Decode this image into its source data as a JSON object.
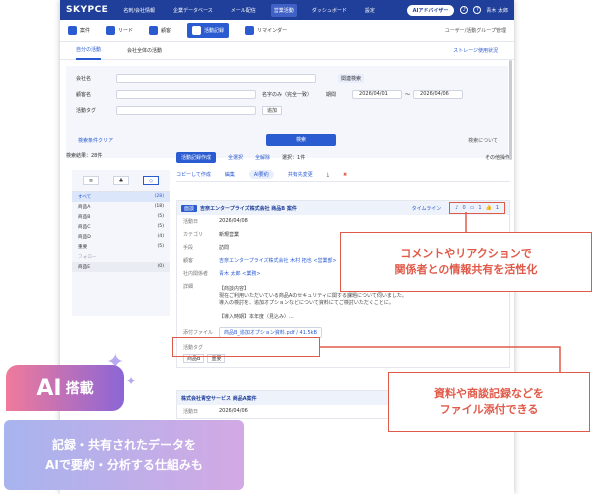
{
  "app": {
    "logo": "SKYPCE"
  },
  "topnav": {
    "items": [
      "名刺/会社情報",
      "企業データベース",
      "メール配信",
      "営業活動",
      "ダッシュボード",
      "設定"
    ],
    "active_index": 3,
    "ai_button": "AIアドバイザー",
    "bell_icon": "bell-icon",
    "help_icon": "help-icon",
    "user": "青木 太郎"
  },
  "modules": {
    "items": [
      "案件",
      "リード",
      "顧客",
      "活動記録",
      "リマインダー"
    ],
    "active_index": 3,
    "right": "ユーザー/活動グループ管理"
  },
  "subtabs": {
    "items": [
      "自分の活動",
      "会社全体の活動"
    ],
    "active_index": 0,
    "right": "ストレージ使用状況"
  },
  "search": {
    "company_label": "会社名",
    "name_label": "顧客名",
    "name_option": "名字のみ（完全一致）",
    "tag_label": "活動タグ",
    "tag_button": "追加",
    "related_label": "関連検索",
    "date_label": "期間",
    "date_from": "2026/04/01",
    "date_sep": "〜",
    "date_to": "2026/04/06",
    "clear": "検索条件クリア",
    "search_button": "検索",
    "about": "検索について"
  },
  "list": {
    "count_label": "検索結果：28件"
  },
  "left_panel": {
    "items": [
      {
        "label": "すべて",
        "count": "(28)",
        "selected": true
      },
      {
        "label": "商品A",
        "count": "(18)"
      },
      {
        "label": "商品B",
        "count": "(5)"
      },
      {
        "label": "商品C",
        "count": "(5)"
      },
      {
        "label": "商品D",
        "count": "(4)"
      },
      {
        "label": "重要",
        "count": "(5)"
      },
      {
        "label": "フォロー",
        "count": "",
        "muted": true
      },
      {
        "label": "商品E",
        "count": "(0)"
      }
    ]
  },
  "toolbar": {
    "new_button": "活動記録作成",
    "select_all": "全選択",
    "deselect": "全解除",
    "selected": "選択：1件",
    "more": "その他操作",
    "copy": "コピーして作成",
    "edit": "編集",
    "ai": "AI要約",
    "share": "共有先変更",
    "download_icon": "download-icon",
    "delete_icon": "trash-icon"
  },
  "card1": {
    "tag": "面談",
    "title": "吉奈エンタープライズ株式会社 商品B 案件",
    "timeline": "タイムライン",
    "comments": "0",
    "replies": "1",
    "likes": "1",
    "rows": [
      {
        "k": "活動日",
        "v": "2026/04/08"
      },
      {
        "k": "カテゴリ",
        "v": "新規営業"
      },
      {
        "k": "手段",
        "v": "訪問"
      },
      {
        "k": "顧客",
        "v": "吉奈エンタープライズ株式会社 木村 拓也 <営業部>"
      },
      {
        "k": "社内関係者",
        "v": "青木 太郎 <業務>"
      }
    ],
    "memo_label": "詳細",
    "memo_lines": [
      "【商談内容】",
      "現在ご利用いただいている商品Aのセキュリティに関する課題について伺いました。",
      "導入の検討を、追加オプションなどについて資料にてご検討いただくことに。",
      "",
      "【導入時期】本年度（見込み）..."
    ],
    "attach_label": "添付ファイル",
    "attach_file": "商品B_追加オプション資料.pdf",
    "attach_size": "41.5kB",
    "tags_label": "活動タグ",
    "tags": [
      "商品B",
      "重要"
    ]
  },
  "card2": {
    "title": "株式会社青空サービス 商品A案件",
    "rows": [
      {
        "k": "活動日",
        "v": "2026/04/06"
      }
    ]
  },
  "callouts": {
    "share": [
      "コメントやリアクションで",
      "関係者との情報共有を活性化"
    ],
    "attach": [
      "資料や商談記録などを",
      "ファイル添付できる"
    ]
  },
  "ai_badge": {
    "ai": "AI",
    "label": "搭載"
  },
  "ai_desc": [
    "記録・共有されたデータを",
    "AIで要約・分析する仕組みも"
  ]
}
